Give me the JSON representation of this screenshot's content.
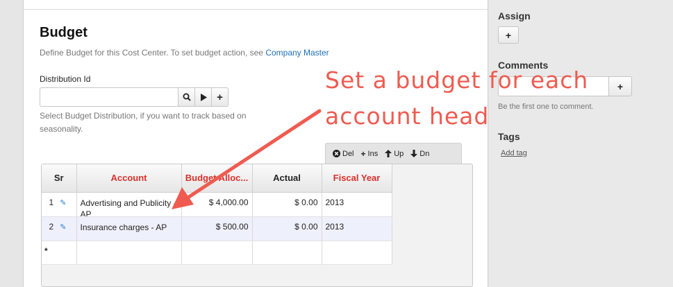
{
  "page": {
    "title": "Budget",
    "description": "Define Budget for this Cost Center. To set budget action, see ",
    "description_link": "Company Master"
  },
  "distribution": {
    "label": "Distribution Id",
    "value": "",
    "hint": "Select Budget Distribution, if you want to track based on seasonality.",
    "buttons": [
      "search-icon",
      "play-icon",
      "plus-icon"
    ]
  },
  "grid_toolbar": {
    "del_label": "Del",
    "ins_label": "Ins",
    "up_label": "Up",
    "dn_label": "Dn"
  },
  "grid": {
    "headers": [
      "Sr",
      "Account",
      "Budget Alloc...",
      "Actual",
      "Fiscal Year"
    ],
    "rows": [
      {
        "sr": "1",
        "account": "Advertising and Publicity - AP",
        "budget": "$ 4,000.00",
        "actual": "$ 0.00",
        "fiscal_year": "2013"
      },
      {
        "sr": "2",
        "account": "Insurance charges - AP",
        "budget": "$ 500.00",
        "actual": "$ 0.00",
        "fiscal_year": "2013"
      }
    ],
    "new_row_marker": "*"
  },
  "sidebar": {
    "assign_label": "Assign",
    "comments_label": "Comments",
    "comment_placeholder": "",
    "comment_note": "Be the first one to comment.",
    "tags_label": "Tags",
    "add_tag": "Add tag"
  },
  "annotation": {
    "line1": "Set a budget for each",
    "line2": "account head",
    "color": "#ef5b50"
  }
}
